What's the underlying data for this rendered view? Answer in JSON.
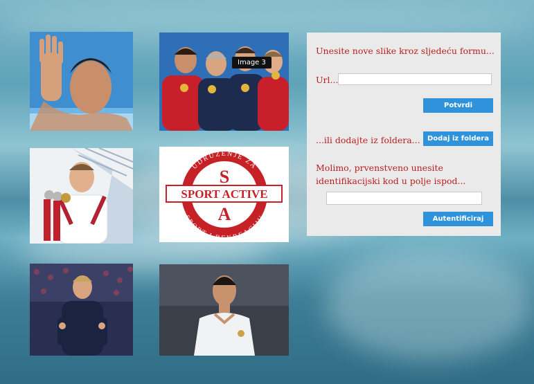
{
  "gallery": {
    "tooltip": "Image 3",
    "logo": {
      "top_text": "UDRUŽENJE ZA",
      "bottom_text": "SPORT I REKREACIJU",
      "main_text": "SPORT ACTIVE",
      "letter_top": "S",
      "letter_bottom": "A"
    }
  },
  "form": {
    "title": "Unesite nove slike kroz sljedeću formu...",
    "url_label": "Url...",
    "url_value": "",
    "confirm_label": "Potvrdi",
    "folder_label": "...ili dodajte iz foldera...",
    "folder_button_label": "Dodaj iz foldera",
    "message": "Molimo, prvenstveno unesite identifikacijski kod u polje ispod...",
    "code_value": "",
    "authenticate_label": "Autentificiraj"
  },
  "colors": {
    "accent_button": "#2f93dc",
    "form_text": "#b81f1f",
    "panel_bg": "#eaeaea"
  }
}
